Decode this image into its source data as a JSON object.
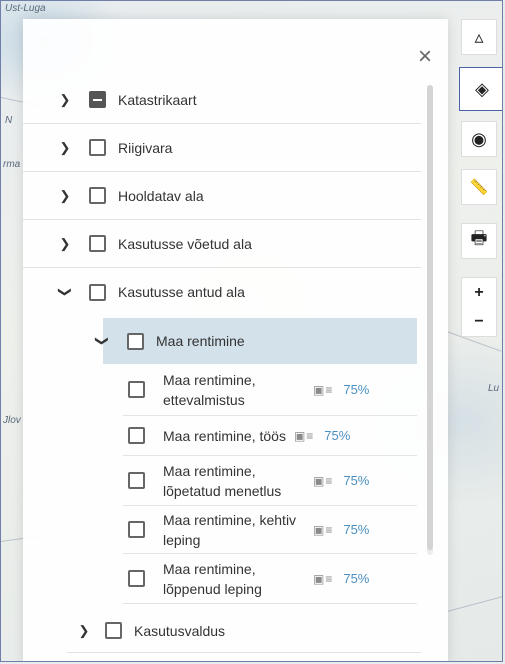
{
  "map": {
    "labels": [
      "Ust-Luga",
      "N",
      "rma",
      "Lu",
      "Jlov"
    ]
  },
  "toolbar": {
    "tools": [
      {
        "name": "shapes-icon",
        "glyph": "▵"
      },
      {
        "name": "layers-icon",
        "glyph": "◈"
      },
      {
        "name": "locate-icon",
        "glyph": "◉"
      },
      {
        "name": "ruler-icon",
        "glyph": "📏"
      },
      {
        "name": "print-icon",
        "glyph": "🖶"
      }
    ],
    "zoom_in": "+",
    "zoom_out": "−"
  },
  "panel": {
    "close_glyph": "×",
    "layers": [
      {
        "label": "Katastrikaart",
        "expanded": false,
        "state": "indeterminate"
      },
      {
        "label": "Riigivara",
        "expanded": false,
        "state": "unchecked"
      },
      {
        "label": "Hooldatav ala",
        "expanded": false,
        "state": "unchecked"
      },
      {
        "label": "Kasutusse võetud ala",
        "expanded": false,
        "state": "unchecked"
      },
      {
        "label": "Kasutusse antud ala",
        "expanded": true,
        "state": "unchecked"
      }
    ],
    "sublayer": {
      "label": "Maa rentimine",
      "expanded": true
    },
    "leaves": [
      {
        "label": "Maa rentimine, ettevalmistus",
        "legend": "▣≡",
        "opacity": "75%"
      },
      {
        "label": "Maa rentimine, töös",
        "legend": "▣≡",
        "opacity": "75%"
      },
      {
        "label": "Maa rentimine, lõpetatud menetlus",
        "legend": "▣≡",
        "opacity": "75%"
      },
      {
        "label": "Maa rentimine, kehtiv leping",
        "legend": "▣≡",
        "opacity": "75%"
      },
      {
        "label": "Maa rentimine, lõppenud leping",
        "legend": "▣≡",
        "opacity": "75%"
      }
    ],
    "last_layer": {
      "label": "Kasutusvaldus",
      "expanded": false
    }
  }
}
